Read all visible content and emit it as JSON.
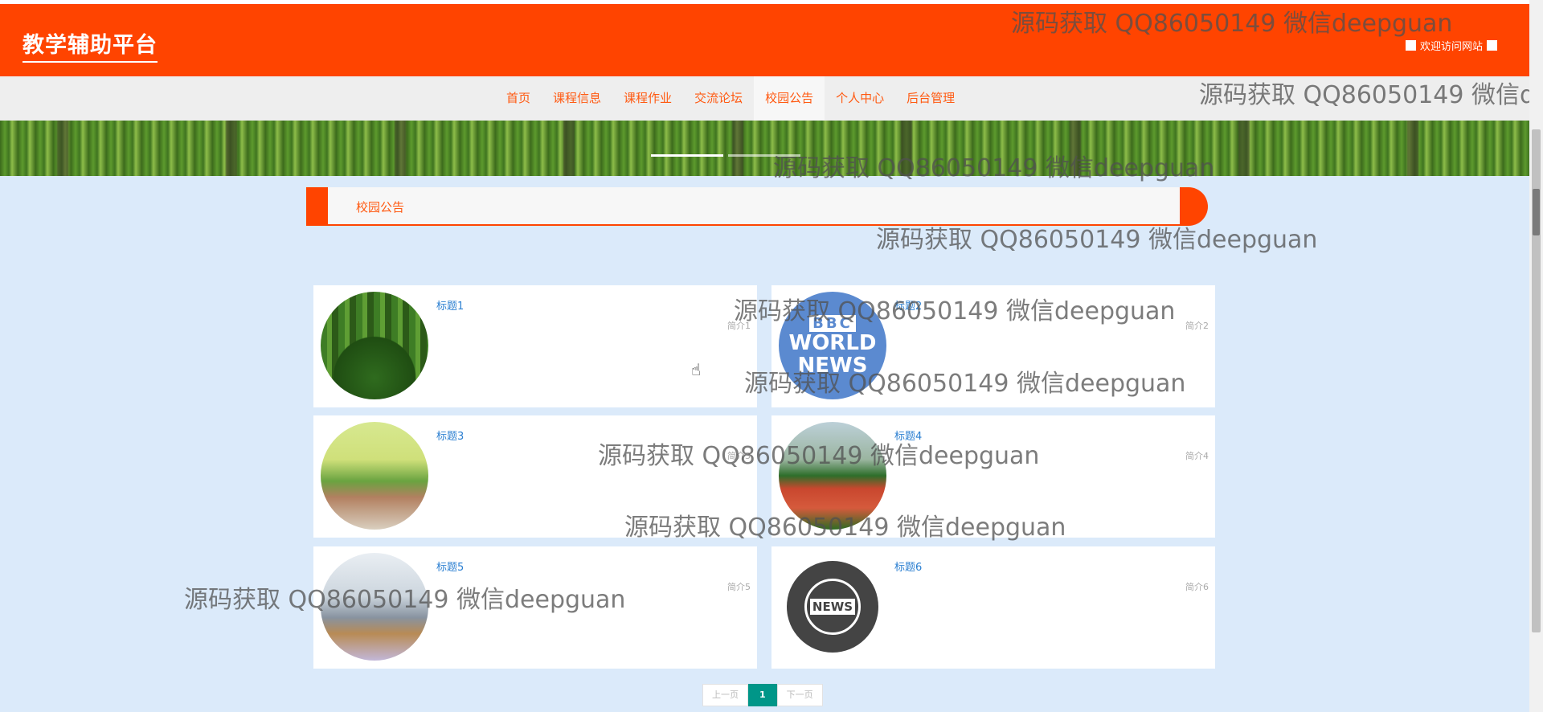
{
  "header": {
    "brand": "教学辅助平台",
    "welcome": "欢迎访问网站"
  },
  "nav": {
    "items": [
      "首页",
      "课程信息",
      "课程作业",
      "交流论坛",
      "校园公告",
      "个人中心",
      "后台管理"
    ],
    "active": "校园公告"
  },
  "section": {
    "title": "校园公告"
  },
  "cards": [
    {
      "title": "标题1",
      "desc": "简介1",
      "image": "forest-path"
    },
    {
      "title": "标题2",
      "desc": "简介2",
      "image": "bbc-world-news-logo"
    },
    {
      "title": "标题3",
      "desc": "简介3",
      "image": "campus-trees"
    },
    {
      "title": "标题4",
      "desc": "简介4",
      "image": "sports-field"
    },
    {
      "title": "标题5",
      "desc": "简介5",
      "image": "building-atrium"
    },
    {
      "title": "标题6",
      "desc": "简介6",
      "image": "news-globe-icon"
    }
  ],
  "bbc_logo": {
    "line1": "BBC",
    "line2": "WORLD",
    "line3": "NEWS"
  },
  "news_icon_text": "NEWS",
  "pagination": {
    "prev": "上一页",
    "current": "1",
    "next": "下一页"
  },
  "watermark": "源码获取 QQ86050149 微信deepguan",
  "colors": {
    "primary": "#ff4400",
    "link": "#2b7fd1",
    "page_active": "#009688",
    "content_bg": "#dbeafa"
  }
}
